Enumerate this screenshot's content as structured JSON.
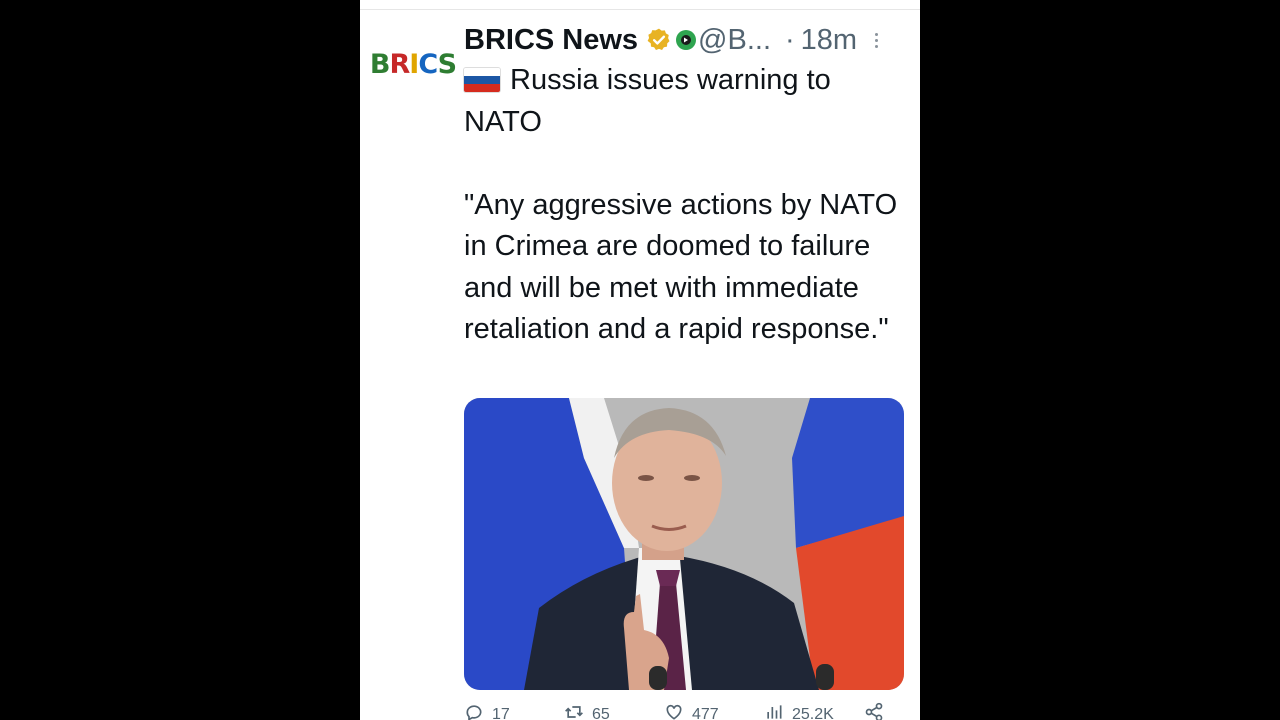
{
  "tweet": {
    "avatar_text": "BRICS",
    "display_name": "BRICS News",
    "handle": "@B...",
    "separator": "·",
    "time": "18m",
    "flag": "🇷🇺",
    "line1": "Russia issues warning to NATO",
    "quote": "\"Any aggressive actions by NATO in Crimea are doomed to failure and will be met with immediate retaliation and a rapid response.\"",
    "icons": {
      "verified": "verified-badge-icon",
      "affiliation": "affiliation-badge-icon",
      "more": "more-options-icon"
    }
  },
  "media": {
    "description_colors": {
      "flag_white": "#f1f1f1",
      "flag_blue": "#2a49c7",
      "flag_red": "#e2492c",
      "suit": "#1f2636",
      "tie": "#5a2347"
    }
  },
  "actions": {
    "reply": "17",
    "retweet": "65",
    "like": "477",
    "views": "25.2K"
  }
}
